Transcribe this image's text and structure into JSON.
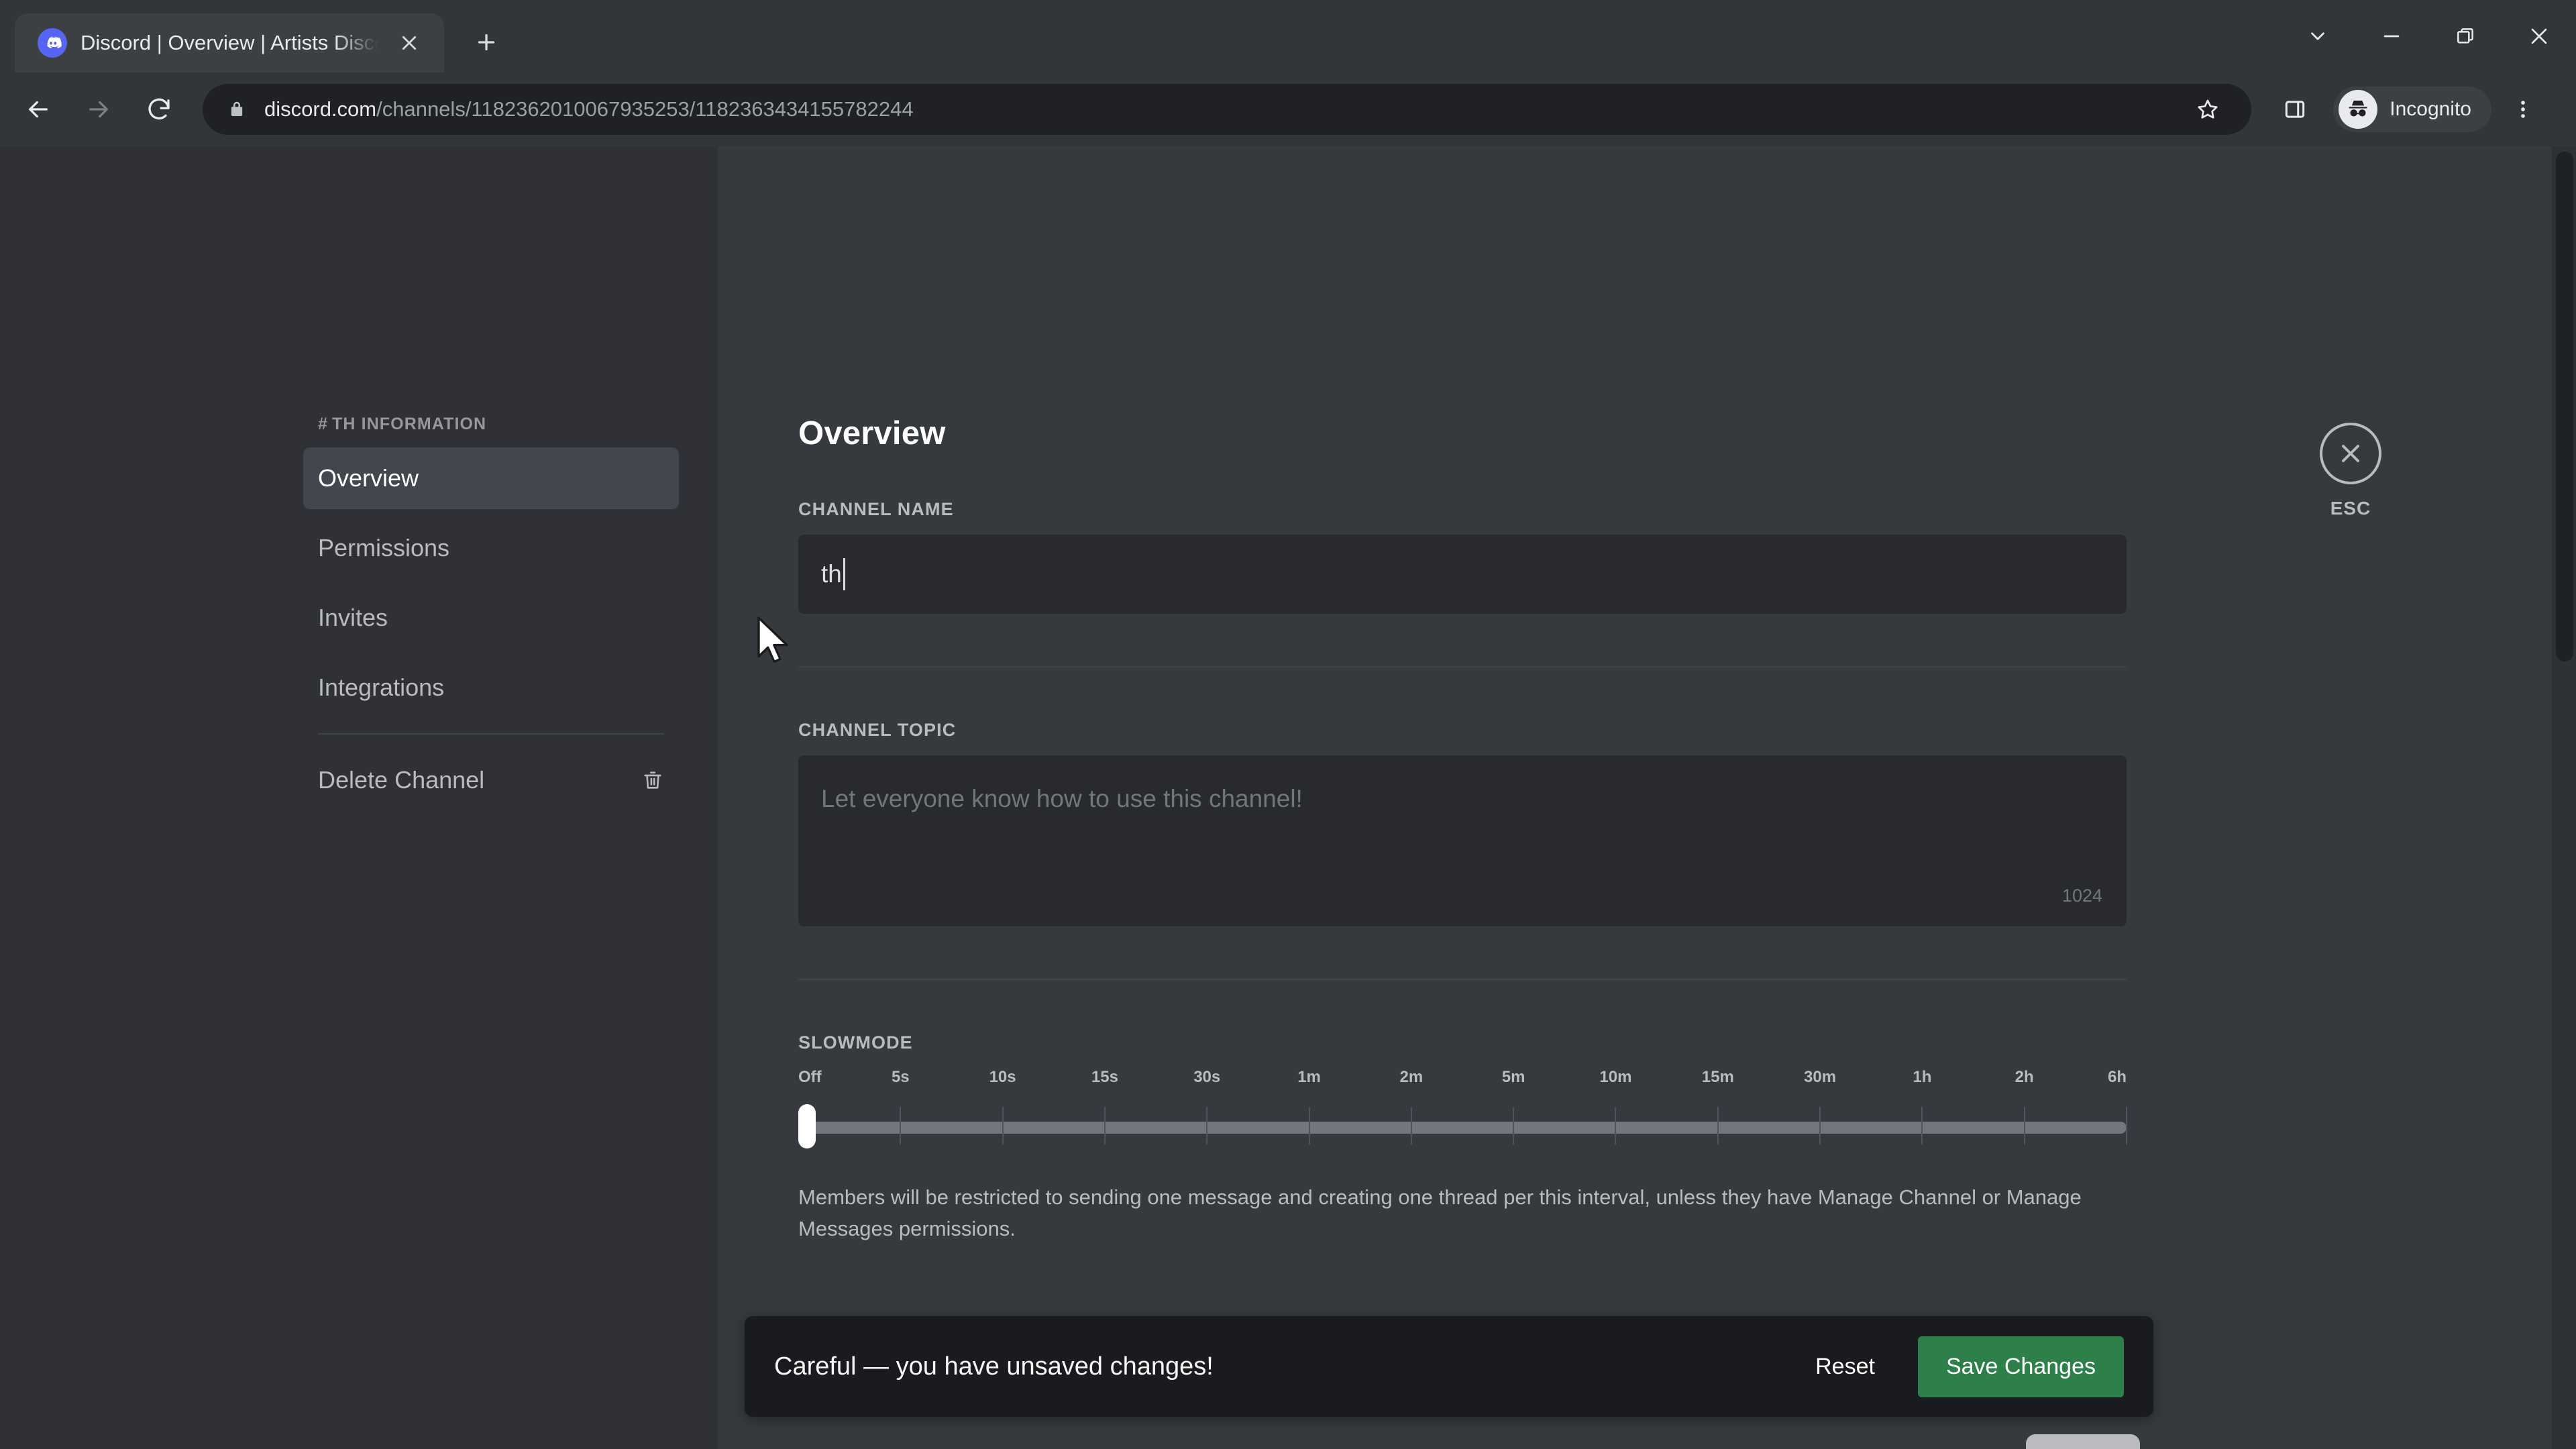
{
  "browser": {
    "tab": {
      "title": "Discord | Overview | Artists Disco",
      "favicon_icon": "discord-icon",
      "close_icon": "close-icon"
    },
    "new_tab_icon": "plus-icon",
    "window_controls": {
      "tab_search_icon": "chevron-down-icon",
      "minimize_icon": "minimize-icon",
      "restore_icon": "restore-icon",
      "close_icon": "close-icon"
    },
    "nav": {
      "back_icon": "back-arrow-icon",
      "forward_icon": "forward-arrow-icon",
      "reload_icon": "reload-icon"
    },
    "omnibox": {
      "lock_icon": "lock-icon",
      "url_domain": "discord.com",
      "url_path": "/channels/1182362010067935253/1182363434155782244",
      "bookmark_icon": "star-icon",
      "side_panel_icon": "side-panel-icon"
    },
    "profile": {
      "label": "Incognito",
      "avatar_icon": "incognito-icon"
    },
    "menu_icon": "three-dot-menu-icon"
  },
  "settings": {
    "sidebar": {
      "header": "TH INFORMATION",
      "header_hash": "#",
      "items": [
        {
          "label": "Overview",
          "active": true
        },
        {
          "label": "Permissions",
          "active": false
        },
        {
          "label": "Invites",
          "active": false
        },
        {
          "label": "Integrations",
          "active": false
        }
      ],
      "delete": {
        "label": "Delete Channel",
        "icon": "trash-icon"
      }
    },
    "close": {
      "icon": "close-circle-icon",
      "label": "ESC"
    },
    "main": {
      "title": "Overview",
      "channel_name": {
        "label": "CHANNEL NAME",
        "value": "th"
      },
      "channel_topic": {
        "label": "CHANNEL TOPIC",
        "placeholder": "Let everyone know how to use this channel!",
        "value": "",
        "counter": "1024"
      },
      "slowmode": {
        "label": "SLOWMODE",
        "ticks": [
          "Off",
          "5s",
          "10s",
          "15s",
          "30s",
          "1m",
          "2m",
          "5m",
          "10m",
          "15m",
          "30m",
          "1h",
          "2h",
          "6h"
        ],
        "selected": "Off",
        "selected_index": 0,
        "description": "Members will be restricted to sending one message and creating one thread per this interval, unless they have Manage Channel or Manage Messages permissions."
      }
    },
    "save_bar": {
      "message": "Careful — you have unsaved changes!",
      "reset_label": "Reset",
      "save_label": "Save Changes",
      "save_color": "#2d8049"
    }
  },
  "colors": {
    "app_background": "#36393e",
    "sidebar_background": "#2f3136",
    "input_background": "#282a2e",
    "active_item": "#42464d",
    "accent_green": "#2d8049",
    "brand_blurple": "#5865f2"
  }
}
